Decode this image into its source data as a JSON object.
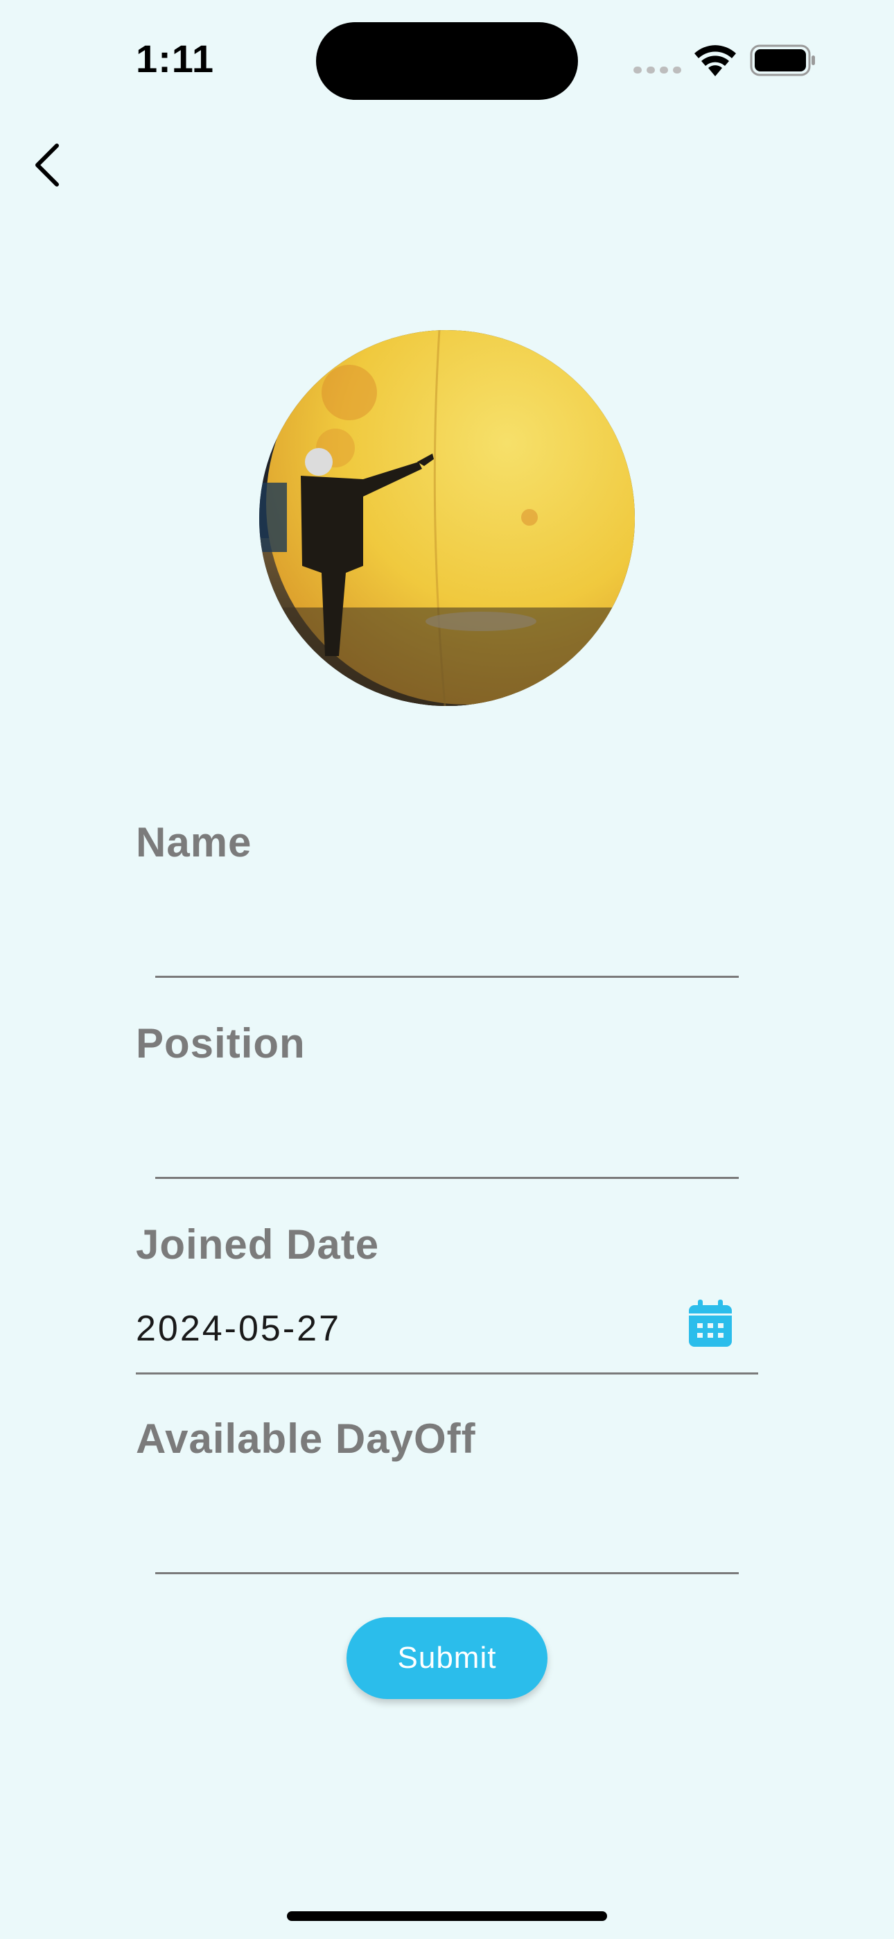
{
  "status_bar": {
    "time": "1:11"
  },
  "icons": {
    "back": "chevron-left-icon",
    "calendar": "calendar-icon",
    "wifi": "wifi-icon",
    "battery": "battery-icon",
    "signal": "cellular-signal-icon"
  },
  "form": {
    "name_label": "Name",
    "name_value": "",
    "position_label": "Position",
    "position_value": "",
    "joined_date_label": "Joined Date",
    "joined_date_value": "2024-05-27",
    "dayoff_label": "Available DayOff",
    "dayoff_value": ""
  },
  "submit_label": "Submit",
  "colors": {
    "background": "#ebf9fa",
    "accent": "#2bbdeb",
    "label": "#7b7b7b"
  }
}
